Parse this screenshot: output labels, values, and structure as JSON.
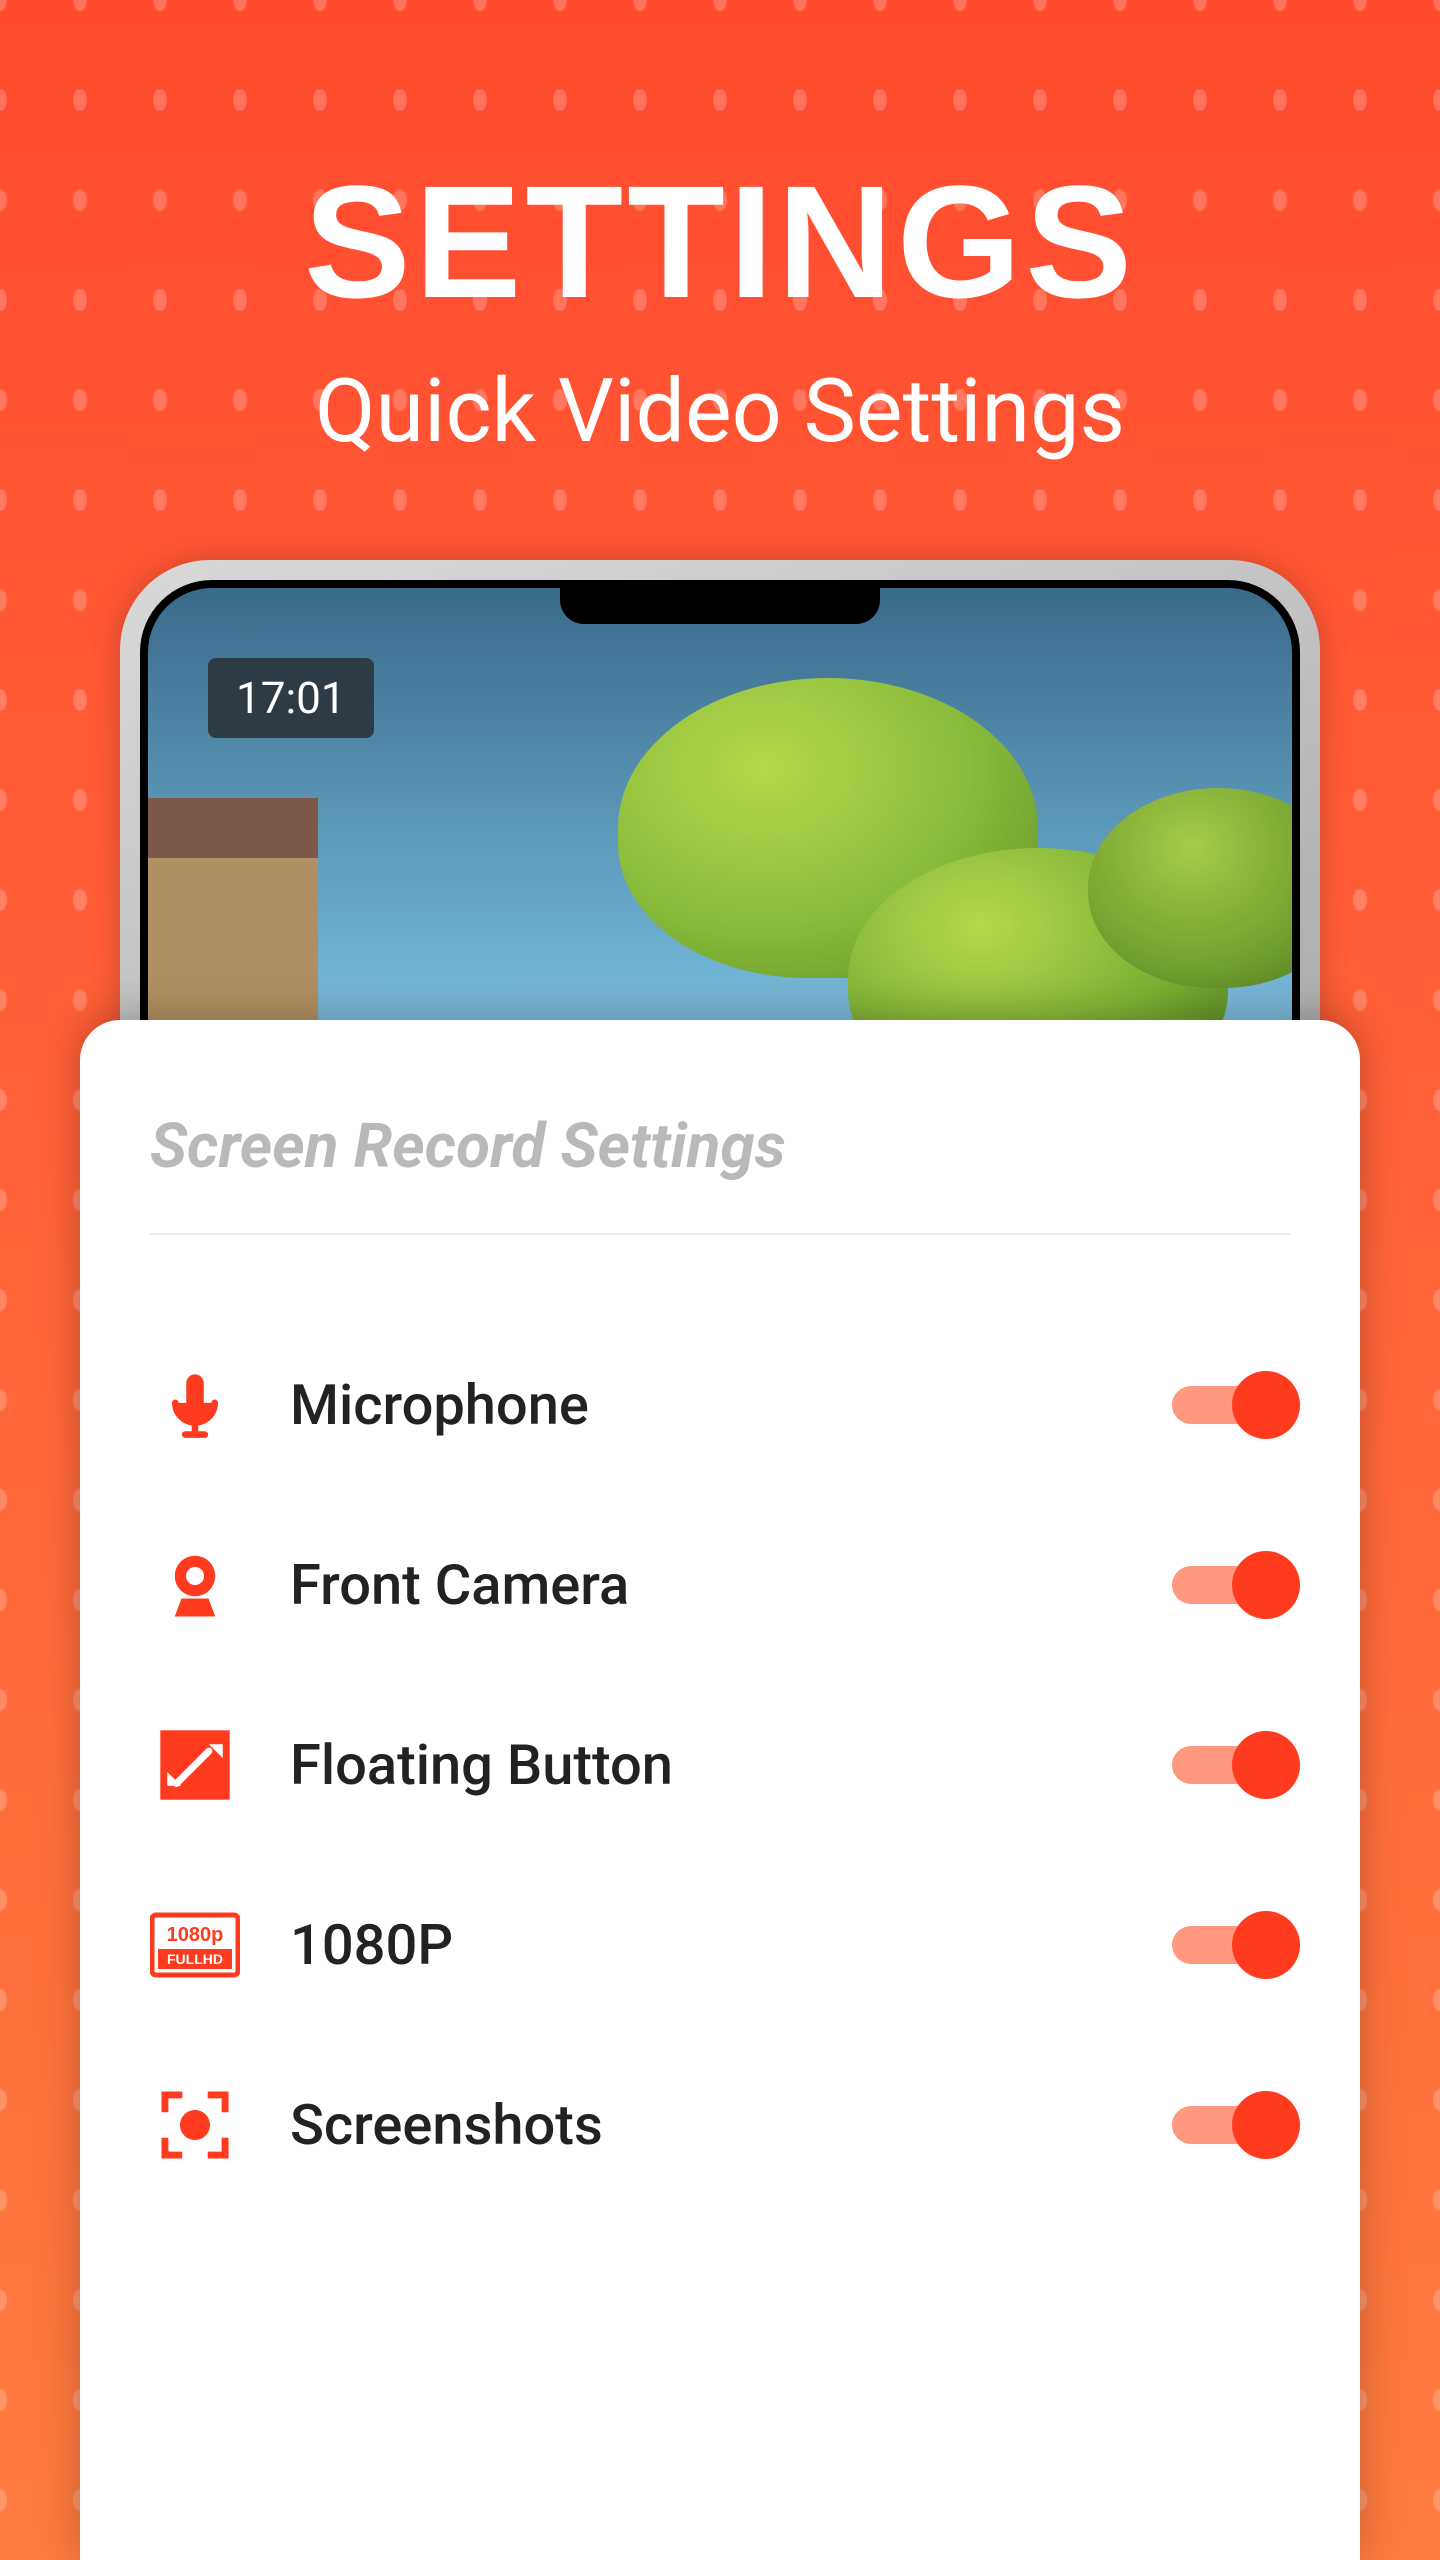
{
  "header": {
    "title": "SETTINGS",
    "subtitle": "Quick Video Settings"
  },
  "phone": {
    "status_time": "17:01"
  },
  "panel": {
    "title": "Screen Record Settings"
  },
  "settings": [
    {
      "label": "Microphone",
      "icon": "microphone",
      "enabled": true
    },
    {
      "label": "Front Camera",
      "icon": "camera",
      "enabled": true
    },
    {
      "label": "Floating Button",
      "icon": "floating-button",
      "enabled": true
    },
    {
      "label": "1080P",
      "icon": "1080p",
      "enabled": true
    },
    {
      "label": "Screenshots",
      "icon": "screenshot",
      "enabled": true
    }
  ],
  "colors": {
    "accent": "#ff3b1f"
  }
}
